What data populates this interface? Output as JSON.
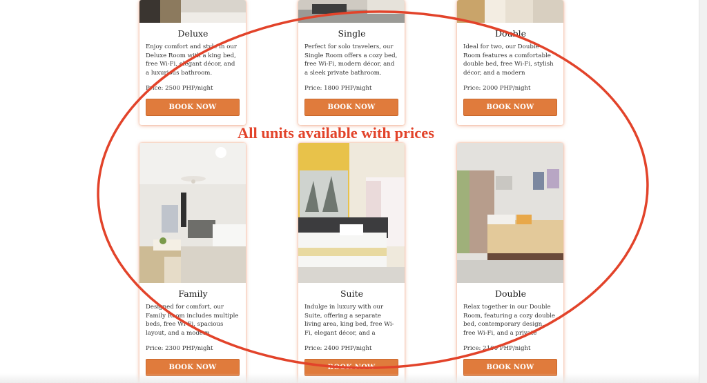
{
  "rooms_top": [
    {
      "title": "Deluxe",
      "description": "Enjoy comfort and style in our Deluxe Room with a king bed, free Wi-Fi, elegant décor, and a luxurious bathroom.",
      "price": "Price: 2500 PHP/night",
      "button": "BOOK NOW"
    },
    {
      "title": "Single",
      "description": "Perfect for solo travelers, our Single Room offers a cozy bed, free Wi-Fi, modern décor, and a sleek private bathroom.",
      "price": "Price: 1800 PHP/night",
      "button": "BOOK NOW"
    },
    {
      "title": "Double",
      "description": "Ideal for two, our Double Room features a comfortable double bed, free Wi-Fi, stylish décor, and a modern bathroom.",
      "price": "Price: 2000 PHP/night",
      "button": "BOOK NOW"
    }
  ],
  "rooms_bottom": [
    {
      "title": "Family",
      "description": "Designed for comfort, our Family Room includes multiple beds, free Wi-Fi, spacious layout, and a modern bathroom for all.",
      "price": "Price: 2300 PHP/night",
      "button": "BOOK NOW"
    },
    {
      "title": "Suite",
      "description": "Indulge in luxury with our Suite, offering a separate living area, king bed, free Wi-Fi, elegant décor, and a premium bathroom.",
      "price": "Price: 2400 PHP/night",
      "button": "BOOK NOW"
    },
    {
      "title": "Double",
      "description": "Relax together in our Double Room, featuring a cozy double bed, contemporary design, free Wi-Fi, and a private bathroom.",
      "price": "Price: 2100 PHP/night",
      "button": "BOOK NOW"
    }
  ],
  "annotation": {
    "text": "All units available with prices",
    "color": "#e2432a"
  },
  "colors": {
    "accent": "#e07b3c",
    "card_glow": "#e8784a"
  }
}
